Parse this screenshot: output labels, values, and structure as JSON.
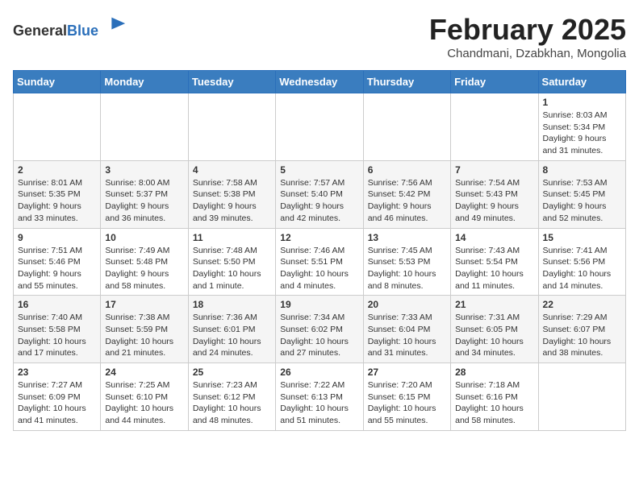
{
  "logo": {
    "general": "General",
    "blue": "Blue"
  },
  "header": {
    "month": "February 2025",
    "location": "Chandmani, Dzabkhan, Mongolia"
  },
  "weekdays": [
    "Sunday",
    "Monday",
    "Tuesday",
    "Wednesday",
    "Thursday",
    "Friday",
    "Saturday"
  ],
  "weeks": [
    [
      {
        "day": "",
        "info": ""
      },
      {
        "day": "",
        "info": ""
      },
      {
        "day": "",
        "info": ""
      },
      {
        "day": "",
        "info": ""
      },
      {
        "day": "",
        "info": ""
      },
      {
        "day": "",
        "info": ""
      },
      {
        "day": "1",
        "info": "Sunrise: 8:03 AM\nSunset: 5:34 PM\nDaylight: 9 hours and 31 minutes."
      }
    ],
    [
      {
        "day": "2",
        "info": "Sunrise: 8:01 AM\nSunset: 5:35 PM\nDaylight: 9 hours and 33 minutes."
      },
      {
        "day": "3",
        "info": "Sunrise: 8:00 AM\nSunset: 5:37 PM\nDaylight: 9 hours and 36 minutes."
      },
      {
        "day": "4",
        "info": "Sunrise: 7:58 AM\nSunset: 5:38 PM\nDaylight: 9 hours and 39 minutes."
      },
      {
        "day": "5",
        "info": "Sunrise: 7:57 AM\nSunset: 5:40 PM\nDaylight: 9 hours and 42 minutes."
      },
      {
        "day": "6",
        "info": "Sunrise: 7:56 AM\nSunset: 5:42 PM\nDaylight: 9 hours and 46 minutes."
      },
      {
        "day": "7",
        "info": "Sunrise: 7:54 AM\nSunset: 5:43 PM\nDaylight: 9 hours and 49 minutes."
      },
      {
        "day": "8",
        "info": "Sunrise: 7:53 AM\nSunset: 5:45 PM\nDaylight: 9 hours and 52 minutes."
      }
    ],
    [
      {
        "day": "9",
        "info": "Sunrise: 7:51 AM\nSunset: 5:46 PM\nDaylight: 9 hours and 55 minutes."
      },
      {
        "day": "10",
        "info": "Sunrise: 7:49 AM\nSunset: 5:48 PM\nDaylight: 9 hours and 58 minutes."
      },
      {
        "day": "11",
        "info": "Sunrise: 7:48 AM\nSunset: 5:50 PM\nDaylight: 10 hours and 1 minute."
      },
      {
        "day": "12",
        "info": "Sunrise: 7:46 AM\nSunset: 5:51 PM\nDaylight: 10 hours and 4 minutes."
      },
      {
        "day": "13",
        "info": "Sunrise: 7:45 AM\nSunset: 5:53 PM\nDaylight: 10 hours and 8 minutes."
      },
      {
        "day": "14",
        "info": "Sunrise: 7:43 AM\nSunset: 5:54 PM\nDaylight: 10 hours and 11 minutes."
      },
      {
        "day": "15",
        "info": "Sunrise: 7:41 AM\nSunset: 5:56 PM\nDaylight: 10 hours and 14 minutes."
      }
    ],
    [
      {
        "day": "16",
        "info": "Sunrise: 7:40 AM\nSunset: 5:58 PM\nDaylight: 10 hours and 17 minutes."
      },
      {
        "day": "17",
        "info": "Sunrise: 7:38 AM\nSunset: 5:59 PM\nDaylight: 10 hours and 21 minutes."
      },
      {
        "day": "18",
        "info": "Sunrise: 7:36 AM\nSunset: 6:01 PM\nDaylight: 10 hours and 24 minutes."
      },
      {
        "day": "19",
        "info": "Sunrise: 7:34 AM\nSunset: 6:02 PM\nDaylight: 10 hours and 27 minutes."
      },
      {
        "day": "20",
        "info": "Sunrise: 7:33 AM\nSunset: 6:04 PM\nDaylight: 10 hours and 31 minutes."
      },
      {
        "day": "21",
        "info": "Sunrise: 7:31 AM\nSunset: 6:05 PM\nDaylight: 10 hours and 34 minutes."
      },
      {
        "day": "22",
        "info": "Sunrise: 7:29 AM\nSunset: 6:07 PM\nDaylight: 10 hours and 38 minutes."
      }
    ],
    [
      {
        "day": "23",
        "info": "Sunrise: 7:27 AM\nSunset: 6:09 PM\nDaylight: 10 hours and 41 minutes."
      },
      {
        "day": "24",
        "info": "Sunrise: 7:25 AM\nSunset: 6:10 PM\nDaylight: 10 hours and 44 minutes."
      },
      {
        "day": "25",
        "info": "Sunrise: 7:23 AM\nSunset: 6:12 PM\nDaylight: 10 hours and 48 minutes."
      },
      {
        "day": "26",
        "info": "Sunrise: 7:22 AM\nSunset: 6:13 PM\nDaylight: 10 hours and 51 minutes."
      },
      {
        "day": "27",
        "info": "Sunrise: 7:20 AM\nSunset: 6:15 PM\nDaylight: 10 hours and 55 minutes."
      },
      {
        "day": "28",
        "info": "Sunrise: 7:18 AM\nSunset: 6:16 PM\nDaylight: 10 hours and 58 minutes."
      },
      {
        "day": "",
        "info": ""
      }
    ]
  ]
}
